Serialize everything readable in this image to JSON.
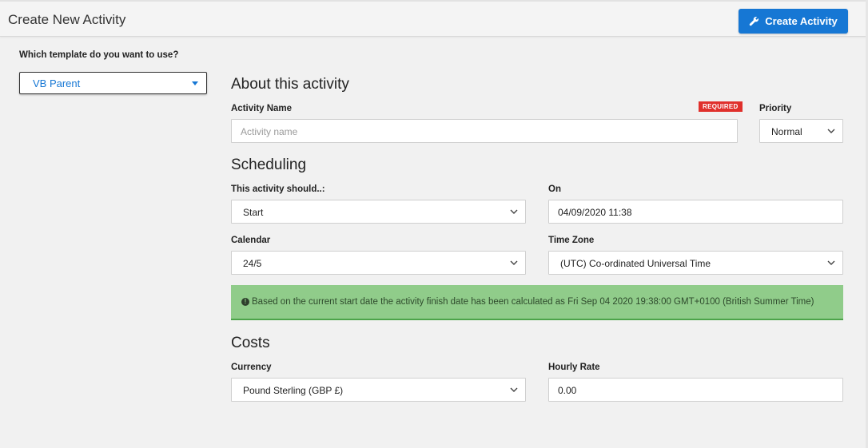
{
  "header": {
    "title": "Create New Activity",
    "create_button_label": "Create Activity"
  },
  "template": {
    "label": "Which template do you want to use?",
    "selected": "VB Parent"
  },
  "about": {
    "heading": "About this activity",
    "activity_name_label": "Activity Name",
    "required_badge": "REQUIRED",
    "activity_name_placeholder": "Activity name",
    "activity_name_value": "",
    "priority_label": "Priority",
    "priority_selected": "Normal"
  },
  "scheduling": {
    "heading": "Scheduling",
    "should_label": "This activity should..:",
    "should_selected": "Start",
    "on_label": "On",
    "on_value": "04/09/2020 11:38",
    "calendar_label": "Calendar",
    "calendar_selected": "24/5",
    "timezone_label": "Time Zone",
    "timezone_selected": "(UTC) Co-ordinated Universal Time",
    "info_message": "Based on the current start date the activity finish date has been calculated as Fri Sep 04 2020 19:38:00 GMT+0100 (British Summer Time)"
  },
  "costs": {
    "heading": "Costs",
    "currency_label": "Currency",
    "currency_selected": "Pound Sterling (GBP £)",
    "hourly_rate_label": "Hourly Rate",
    "hourly_rate_value": "0.00"
  },
  "colors": {
    "accent": "#1677d4",
    "required": "#e0302c",
    "success_bg": "#90cc8a",
    "success_border": "#4da44a"
  },
  "icons": {
    "create_button": "wrench-icon",
    "select_caret": "chevron-down-icon",
    "alert": "info-circle-icon"
  }
}
